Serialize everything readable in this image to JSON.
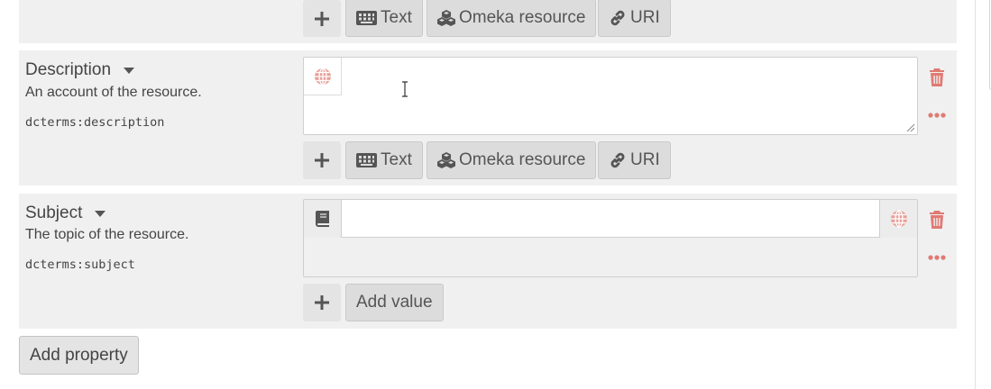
{
  "top_row": {
    "buttons": {
      "text": "Text",
      "resource": "Omeka resource",
      "uri": "URI"
    }
  },
  "description": {
    "label": "Description",
    "comment": "An account of the resource.",
    "term": "dcterms:description",
    "value": "",
    "buttons": {
      "text": "Text",
      "resource": "Omeka resource",
      "uri": "URI"
    }
  },
  "subject": {
    "label": "Subject",
    "comment": "The topic of the resource.",
    "term": "dcterms:subject",
    "value": "",
    "add_value": "Add value"
  },
  "add_property": "Add property",
  "colors": {
    "panel": "#f0f0f0",
    "danger": "#e07a73",
    "button": "#dcdcdc"
  },
  "icons": [
    "plus-icon",
    "keyboard-icon",
    "cubes-icon",
    "link-icon",
    "globe-icon",
    "book-icon",
    "trash-icon",
    "ellipsis-icon",
    "caret-down-icon"
  ]
}
